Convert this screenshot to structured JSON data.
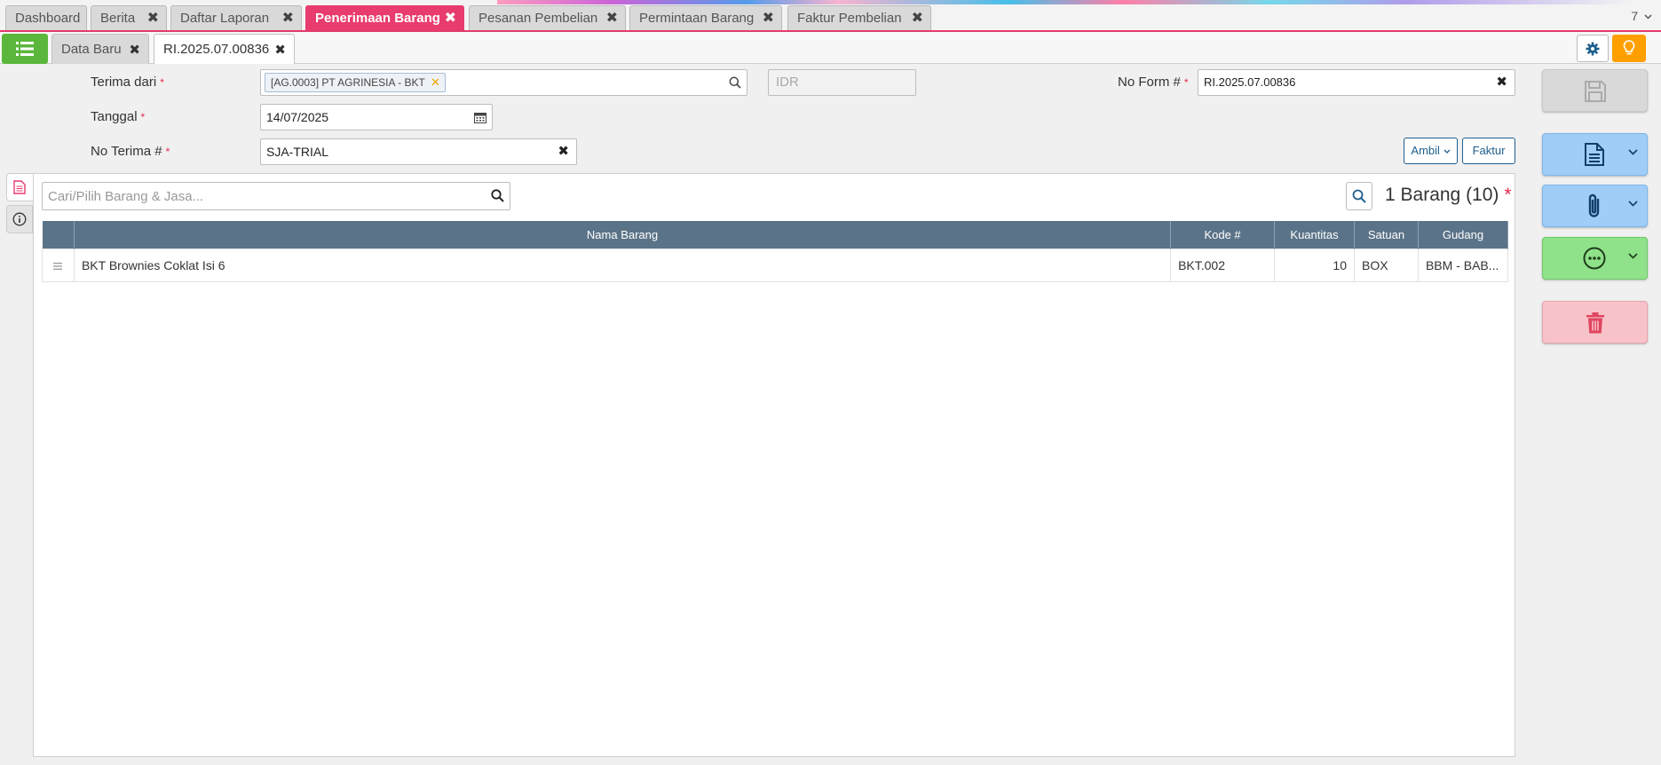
{
  "app": {
    "top_tabs": [
      {
        "label": "Dashboard",
        "closable": false,
        "active": false
      },
      {
        "label": "Berita",
        "closable": true,
        "active": false
      },
      {
        "label": "Daftar Laporan",
        "closable": true,
        "active": false
      },
      {
        "label": "Penerimaan Barang",
        "closable": true,
        "active": true
      },
      {
        "label": "Pesanan Pembelian",
        "closable": true,
        "active": false
      },
      {
        "label": "Permintaan Barang",
        "closable": true,
        "active": false
      },
      {
        "label": "Faktur Pembelian",
        "closable": true,
        "active": false
      }
    ],
    "tab_count": "7",
    "close_glyph": "✖",
    "accent_color": "#e83b6e"
  },
  "subtabs": [
    {
      "label": "Data Baru",
      "active": false
    },
    {
      "label": "RI.2025.07.00836",
      "active": true
    }
  ],
  "form": {
    "terima_dari": {
      "label": "Terima dari",
      "chip": "[AG.0003] PT AGRINESIA - BKT"
    },
    "currency": {
      "placeholder": "IDR"
    },
    "no_form": {
      "label": "No Form #",
      "value": "RI.2025.07.00836"
    },
    "tanggal": {
      "label": "Tanggal",
      "value": "14/07/2025"
    },
    "no_terima": {
      "label": "No Terima #",
      "value": "SJA-TRIAL"
    },
    "required_mark": "*",
    "ambil_label": "Ambil",
    "faktur_label": "Faktur"
  },
  "panel": {
    "search_placeholder": "Cari/Pilih Barang & Jasa...",
    "summary": "1 Barang (10)",
    "columns": [
      "Nama Barang",
      "Kode #",
      "Kuantitas",
      "Satuan",
      "Gudang"
    ],
    "rows": [
      {
        "nama": "BKT Brownies Coklat Isi 6",
        "kode": "BKT.002",
        "qty": "10",
        "satuan": "BOX",
        "gudang": "BBM - BAB..."
      }
    ]
  },
  "actions": {
    "save_color": "#d9d9d9",
    "print_color": "#9fcdf7",
    "attach_color": "#9fcdf7",
    "more_color": "#8fe28a",
    "delete_color": "#f8c2c9"
  }
}
